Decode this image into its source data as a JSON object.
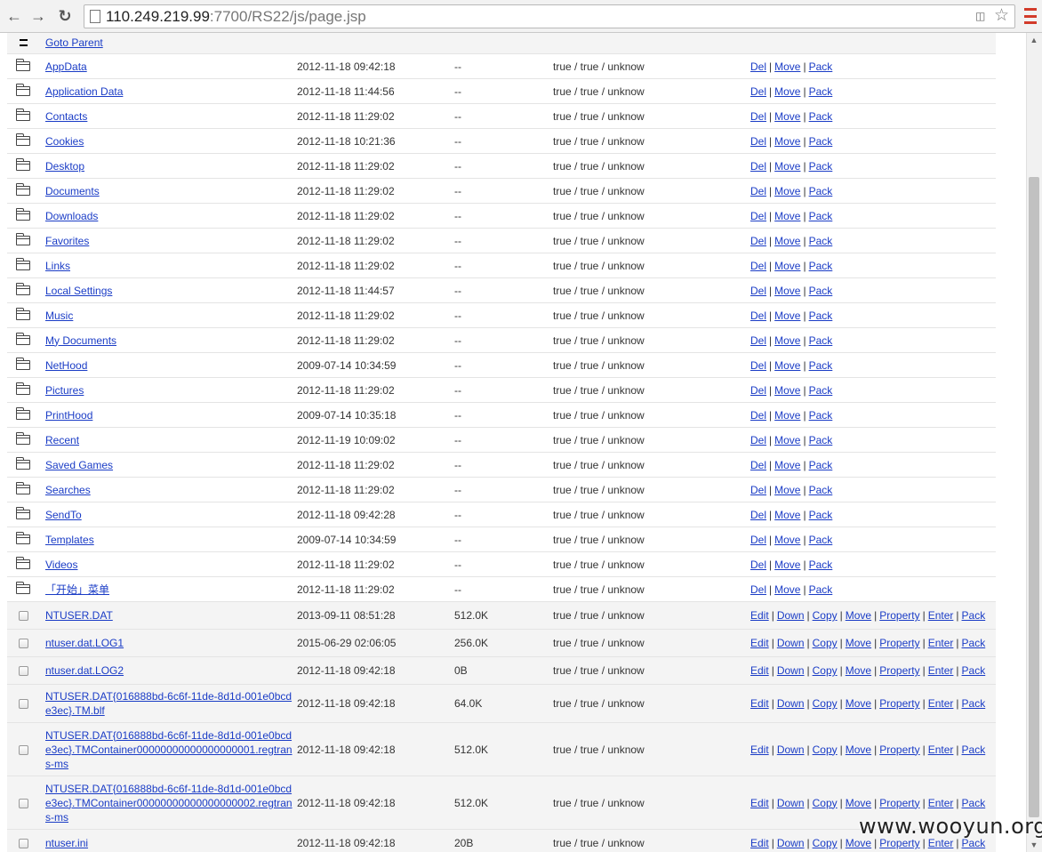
{
  "browser": {
    "url_host": "110.249.219.99",
    "url_rest": ":7700/RS22/js/page.jsp",
    "icons": {
      "back": "arrow-left-icon",
      "forward": "arrow-right-icon",
      "reload": "reload-icon",
      "star": "star-icon",
      "menu": "menu-icon",
      "translate": "translate-icon"
    },
    "menu_color": "#d23b2a"
  },
  "link_color": "#1a3cc6",
  "goto_parent": "Goto Parent",
  "dir_actions": [
    "Del",
    "Move",
    "Pack"
  ],
  "file_actions": [
    "Edit",
    "Down",
    "Copy",
    "Move",
    "Property",
    "Enter",
    "Pack"
  ],
  "directories": [
    {
      "name": "AppData",
      "date": "2012-11-18 09:42:18",
      "size": "--",
      "perm": "true / true / unknow"
    },
    {
      "name": "Application Data",
      "date": "2012-11-18 11:44:56",
      "size": "--",
      "perm": "true / true / unknow"
    },
    {
      "name": "Contacts",
      "date": "2012-11-18 11:29:02",
      "size": "--",
      "perm": "true / true / unknow"
    },
    {
      "name": "Cookies",
      "date": "2012-11-18 10:21:36",
      "size": "--",
      "perm": "true / true / unknow"
    },
    {
      "name": "Desktop",
      "date": "2012-11-18 11:29:02",
      "size": "--",
      "perm": "true / true / unknow"
    },
    {
      "name": "Documents",
      "date": "2012-11-18 11:29:02",
      "size": "--",
      "perm": "true / true / unknow"
    },
    {
      "name": "Downloads",
      "date": "2012-11-18 11:29:02",
      "size": "--",
      "perm": "true / true / unknow"
    },
    {
      "name": "Favorites",
      "date": "2012-11-18 11:29:02",
      "size": "--",
      "perm": "true / true / unknow"
    },
    {
      "name": "Links",
      "date": "2012-11-18 11:29:02",
      "size": "--",
      "perm": "true / true / unknow"
    },
    {
      "name": "Local Settings",
      "date": "2012-11-18 11:44:57",
      "size": "--",
      "perm": "true / true / unknow"
    },
    {
      "name": "Music",
      "date": "2012-11-18 11:29:02",
      "size": "--",
      "perm": "true / true / unknow"
    },
    {
      "name": "My Documents",
      "date": "2012-11-18 11:29:02",
      "size": "--",
      "perm": "true / true / unknow"
    },
    {
      "name": "NetHood",
      "date": "2009-07-14 10:34:59",
      "size": "--",
      "perm": "true / true / unknow"
    },
    {
      "name": "Pictures",
      "date": "2012-11-18 11:29:02",
      "size": "--",
      "perm": "true / true / unknow"
    },
    {
      "name": "PrintHood",
      "date": "2009-07-14 10:35:18",
      "size": "--",
      "perm": "true / true / unknow"
    },
    {
      "name": "Recent",
      "date": "2012-11-19 10:09:02",
      "size": "--",
      "perm": "true / true / unknow"
    },
    {
      "name": "Saved Games",
      "date": "2012-11-18 11:29:02",
      "size": "--",
      "perm": "true / true / unknow"
    },
    {
      "name": "Searches",
      "date": "2012-11-18 11:29:02",
      "size": "--",
      "perm": "true / true / unknow"
    },
    {
      "name": "SendTo",
      "date": "2012-11-18 09:42:28",
      "size": "--",
      "perm": "true / true / unknow"
    },
    {
      "name": "Templates",
      "date": "2009-07-14 10:34:59",
      "size": "--",
      "perm": "true / true / unknow"
    },
    {
      "name": "Videos",
      "date": "2012-11-18 11:29:02",
      "size": "--",
      "perm": "true / true / unknow"
    },
    {
      "name": "「开始」菜单",
      "date": "2012-11-18 11:29:02",
      "size": "--",
      "perm": "true / true / unknow"
    }
  ],
  "files": [
    {
      "name": "NTUSER.DAT",
      "date": "2013-09-11 08:51:28",
      "size": "512.0K",
      "perm": "true / true / unknow",
      "rows": 1
    },
    {
      "name": "ntuser.dat.LOG1",
      "date": "2015-06-29 02:06:05",
      "size": "256.0K",
      "perm": "true / true / unknow",
      "rows": 1
    },
    {
      "name": "ntuser.dat.LOG2",
      "date": "2012-11-18 09:42:18",
      "size": "0B",
      "perm": "true / true / unknow",
      "rows": 1
    },
    {
      "name": "NTUSER.DAT{016888bd-6c6f-11de-8d1d-001e0bcde3ec}.TM.blf",
      "date": "2012-11-18 09:42:18",
      "size": "64.0K",
      "perm": "true / true / unknow",
      "rows": 2
    },
    {
      "name": "NTUSER.DAT{016888bd-6c6f-11de-8d1d-001e0bcde3ec}.TMContainer00000000000000000001.regtrans-ms",
      "date": "2012-11-18 09:42:18",
      "size": "512.0K",
      "perm": "true / true / unknow",
      "rows": 3
    },
    {
      "name": "NTUSER.DAT{016888bd-6c6f-11de-8d1d-001e0bcde3ec}.TMContainer00000000000000000002.regtrans-ms",
      "date": "2012-11-18 09:42:18",
      "size": "512.0K",
      "perm": "true / true / unknow",
      "rows": 3
    },
    {
      "name": "ntuser.ini",
      "date": "2012-11-18 09:42:18",
      "size": "20B",
      "perm": "true / true / unknow",
      "rows": 1
    }
  ],
  "watermark": "www.wooyun.org"
}
